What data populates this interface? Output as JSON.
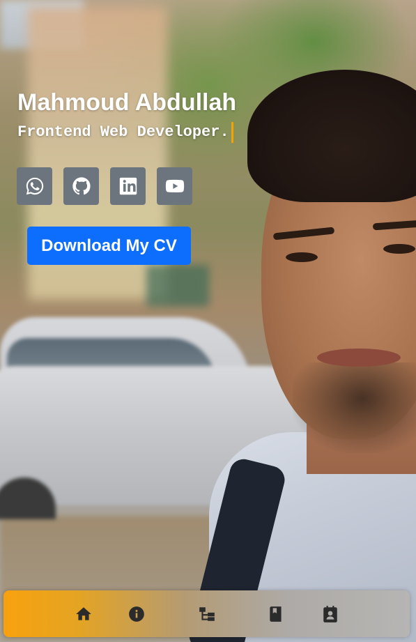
{
  "profile": {
    "name": "Mahmoud Abdullah",
    "role": "Frontend Web Developer."
  },
  "socials": [
    {
      "name": "WhatsApp",
      "icon": "whatsapp-icon"
    },
    {
      "name": "GitHub",
      "icon": "github-icon"
    },
    {
      "name": "LinkedIn",
      "icon": "linkedin-icon"
    },
    {
      "name": "YouTube",
      "icon": "youtube-icon"
    }
  ],
  "cta": {
    "download_cv_label": "Download My CV"
  },
  "nav": {
    "items": [
      {
        "id": "home",
        "icon": "home-icon"
      },
      {
        "id": "about",
        "icon": "info-icon"
      },
      {
        "id": "skills",
        "icon": "sitemap-icon"
      },
      {
        "id": "projects",
        "icon": "book-icon"
      },
      {
        "id": "contact",
        "icon": "contact-card-icon"
      }
    ]
  },
  "colors": {
    "primary_button": "#0d6efd",
    "social_button": "#6c757d",
    "caret": "#f0a500",
    "nav_gradient_start": "#f8a10f",
    "nav_gradient_end": "#b7b5b3"
  }
}
